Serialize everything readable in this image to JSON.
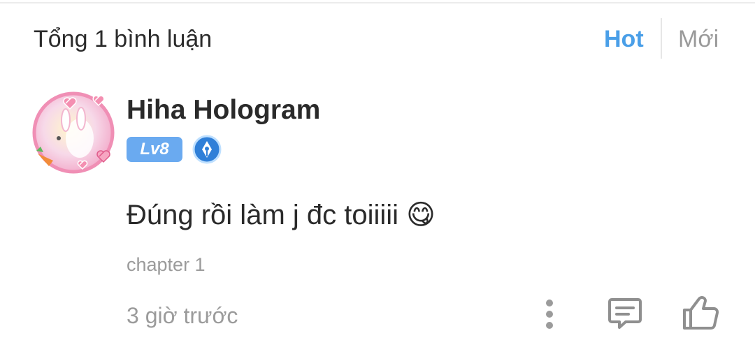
{
  "header": {
    "total_label": "Tổng 1 bình luận",
    "sort_hot": "Hot",
    "sort_new": "Mới"
  },
  "colors": {
    "accent": "#4a9fe8",
    "level_badge": "#6aaaf0",
    "muted_text": "#9b9b9b"
  },
  "comment": {
    "username": "Hiha Hologram",
    "level": "Lv8",
    "text": "Đúng rồi làm j đc toiiiii 😋",
    "chapter": "chapter 1",
    "time": "3 giờ trước",
    "icons": {
      "avatar": "avatar-icon",
      "badge": "pen-badge-icon",
      "more": "more-vertical-icon",
      "reply": "reply-icon",
      "like": "thumbs-up-icon"
    }
  }
}
